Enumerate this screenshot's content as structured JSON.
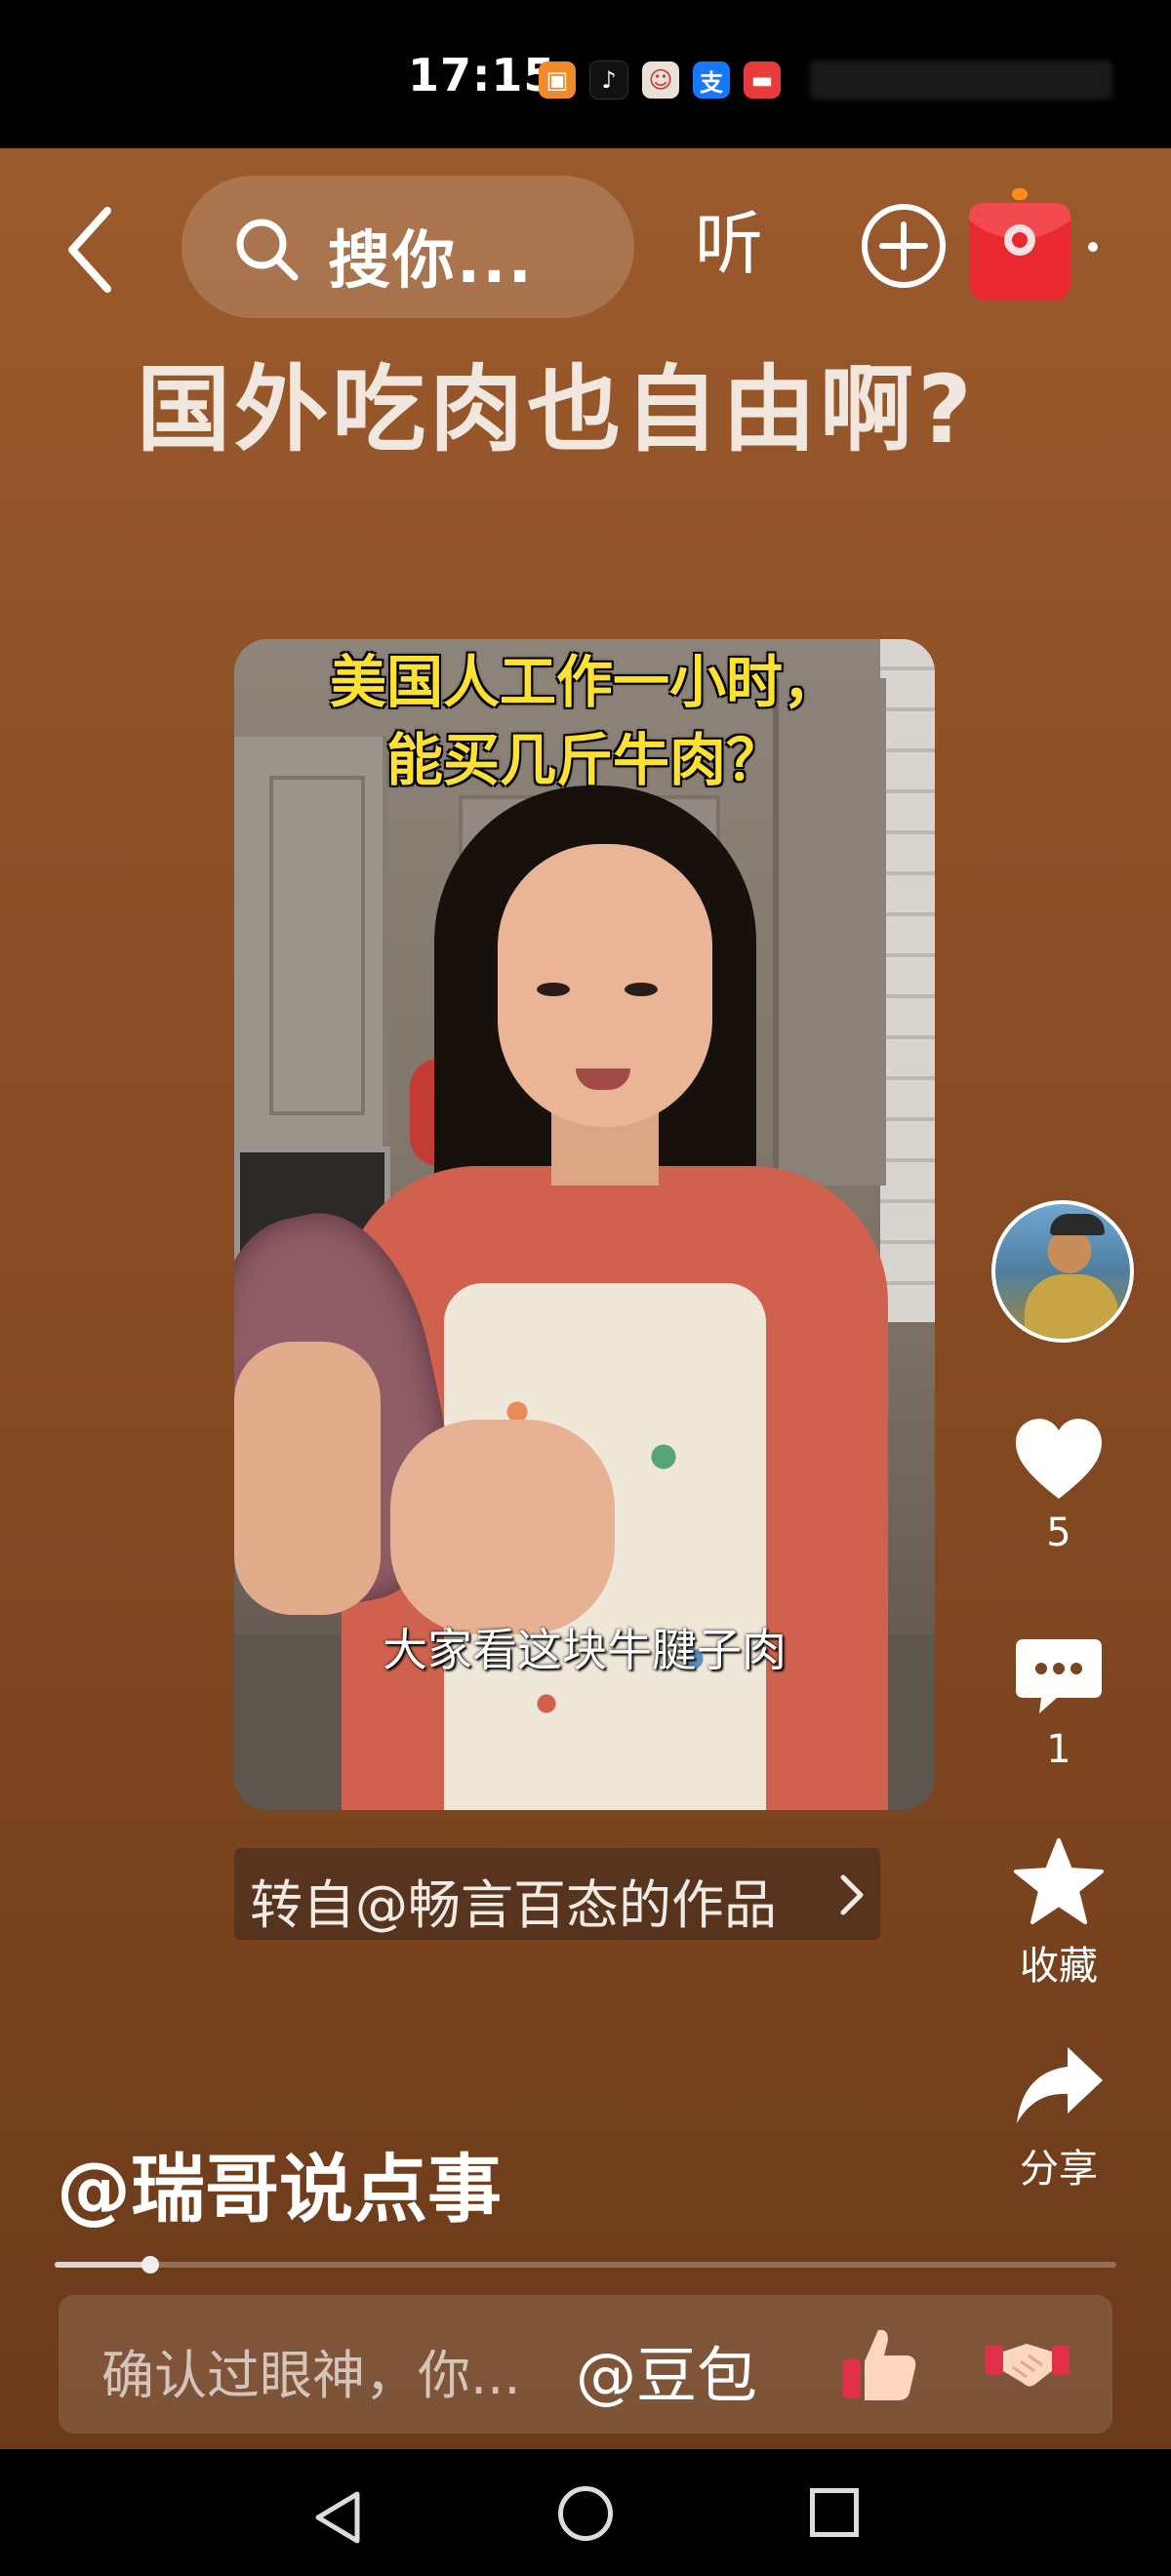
{
  "status_bar": {
    "time": "17:15"
  },
  "header": {
    "search_placeholder": "搜你...",
    "listen_label": "听"
  },
  "post": {
    "title": "国外吃肉也自由啊?",
    "video_caption_top": "美国人工作一小时，\n能买几斤牛肉？",
    "video_subtitle": "大家看这块牛腱子肉",
    "repost_label": "转自@畅言百态的作品",
    "author": "@瑞哥说点事",
    "progress_fraction": 0.09
  },
  "side_actions": {
    "likes_count": "5",
    "comments_count": "1",
    "favorite_label": "收藏",
    "share_label": "分享"
  },
  "comment_bar": {
    "placeholder": "确认过眼神，你...",
    "mention": "@豆包"
  },
  "icons": [
    "back-icon",
    "search-icon",
    "add-icon",
    "red-packet-icon",
    "heart-icon",
    "comment-icon",
    "star-icon",
    "share-icon",
    "thumbs-up-emoji",
    "handshake-emoji"
  ]
}
